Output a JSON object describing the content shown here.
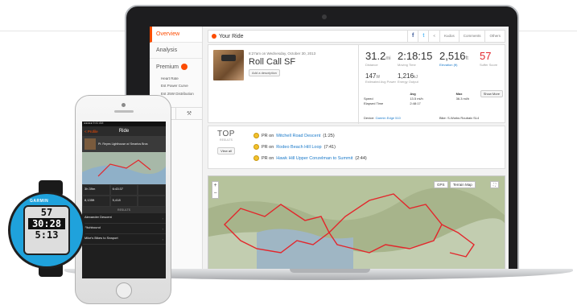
{
  "sidebar": {
    "items": [
      {
        "label": "Overview"
      },
      {
        "label": "Analysis"
      },
      {
        "label": "Premium"
      }
    ],
    "sub_items": [
      "Heart Rate",
      "Est Power Curve",
      "Est 25W Distribution"
    ],
    "tools": [
      "✓",
      "⚒"
    ]
  },
  "header": {
    "title": "Your Ride",
    "facebook": "f",
    "twitter": "t",
    "share": "<",
    "kudos": "Kudos",
    "comments": "Comments",
    "others": "Others"
  },
  "activity": {
    "date": "8:27am on Wednesday, October 30, 2013",
    "name": "Roll Call SF",
    "add_description": "Add a description",
    "stats": {
      "distance": {
        "value": "31.2",
        "unit": "mi",
        "label": "Distance"
      },
      "moving_time": {
        "value": "2:18:15",
        "label": "Moving Time"
      },
      "elevation": {
        "value": "2,516",
        "unit": "ft",
        "label": "Elevation (ft)"
      },
      "suffer": {
        "value": "57",
        "label": "Suffer Score"
      },
      "power": {
        "value": "147",
        "unit": "W",
        "label": "Estimated Avg Power"
      },
      "energy": {
        "value": "1,216",
        "unit": "kJ",
        "label": "Energy Output"
      }
    },
    "table": {
      "headers": [
        "",
        "Avg",
        "Max"
      ],
      "rows": [
        [
          "Speed",
          "13.5 mi/h",
          "36.3 mi/h"
        ],
        [
          "Elapsed Time",
          "2:48:17",
          ""
        ]
      ]
    },
    "show_more": "Show More",
    "device_label": "Device:",
    "device": "Garmin Edge 510",
    "bike": "Bike: S-Works Roubaix SL4"
  },
  "achievements": {
    "top": "TOP",
    "results": "RESULTS",
    "view_all": "View all",
    "prs": [
      {
        "prefix": "PR on",
        "segment": "Mitchell Road Descent",
        "time": "(1:25)"
      },
      {
        "prefix": "PR on",
        "segment": "Rodeo Beach Hill Loop",
        "time": "(7:41)"
      },
      {
        "prefix": "PR on",
        "segment": "Hawk Hill Upper Conzelman to Summit",
        "time": "(2:44)"
      }
    ]
  },
  "map": {
    "gps_label": "GPS",
    "type_label": "Terrain Map",
    "zoom_in": "+",
    "zoom_out": "−",
    "fullscreen": "⛶"
  },
  "phone": {
    "status": "●●●●● 9:41 AM",
    "nav_back": "< Profile",
    "nav_title": "Ride",
    "ride_title": "Pt. Reyes Lighthouse w/ Smartos Bros",
    "stats": [
      "3h 39m",
      "6:43:37",
      "",
      "8,135ft",
      "5,418",
      ""
    ],
    "results_header": "RESULTS",
    "list": [
      {
        "label": "Alexander Descent"
      },
      {
        "label": "Fitchbound"
      },
      {
        "label": "Mike's Bikes to Seaport"
      }
    ]
  },
  "watch": {
    "brand": "GARMIN",
    "line1": "57",
    "line2": "30:28",
    "line3": "5:13"
  },
  "colors": {
    "accent": "#fc4c02",
    "link": "#1a79c9",
    "route": "#e3262b"
  }
}
